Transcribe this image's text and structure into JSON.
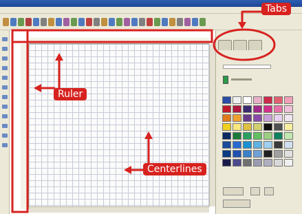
{
  "annotations": {
    "tabs": "Tabs",
    "ruler": "Ruler",
    "centerlines": "Centerlines"
  },
  "palette": [
    "#2a4ea6",
    "#f0f0f0",
    "#ffffff",
    "#e8b0c8",
    "#cc2a4a",
    "#e06070",
    "#f2a0b8",
    "#c01a2a",
    "#b01840",
    "#3a2a70",
    "#a02888",
    "#d0308a",
    "#e870a8",
    "#f0c0d8",
    "#e07a1a",
    "#f0a030",
    "#6a3a8a",
    "#8a4aa8",
    "#c8a0d8",
    "#e8d0f0",
    "#f0e8f0",
    "#f0d020",
    "#f8e880",
    "#e0c040",
    "#d0d070",
    "#101010",
    "#505050",
    "#f8f0a0",
    "#0a2a60",
    "#1a7a3a",
    "#2aa060",
    "#60c060",
    "#9ad080",
    "#108060",
    "#c0e8b0",
    "#1a4a9a",
    "#2a6ad0",
    "#1a90d0",
    "#60b0e0",
    "#a0d0f0",
    "#3a3a3a",
    "#d0e0f0",
    "#0a3a80",
    "#2050b0",
    "#3a80c8",
    "#70a0d8",
    "#202020",
    "#a0a0a0",
    "#e0e0e0",
    "#1a1a4a",
    "#4a4a8a",
    "#707070",
    "#9a9ab0",
    "#b0b0c0",
    "#d8d8d8",
    "#f0f0f0"
  ],
  "colors": {
    "annotation_red": "#d7221f"
  }
}
